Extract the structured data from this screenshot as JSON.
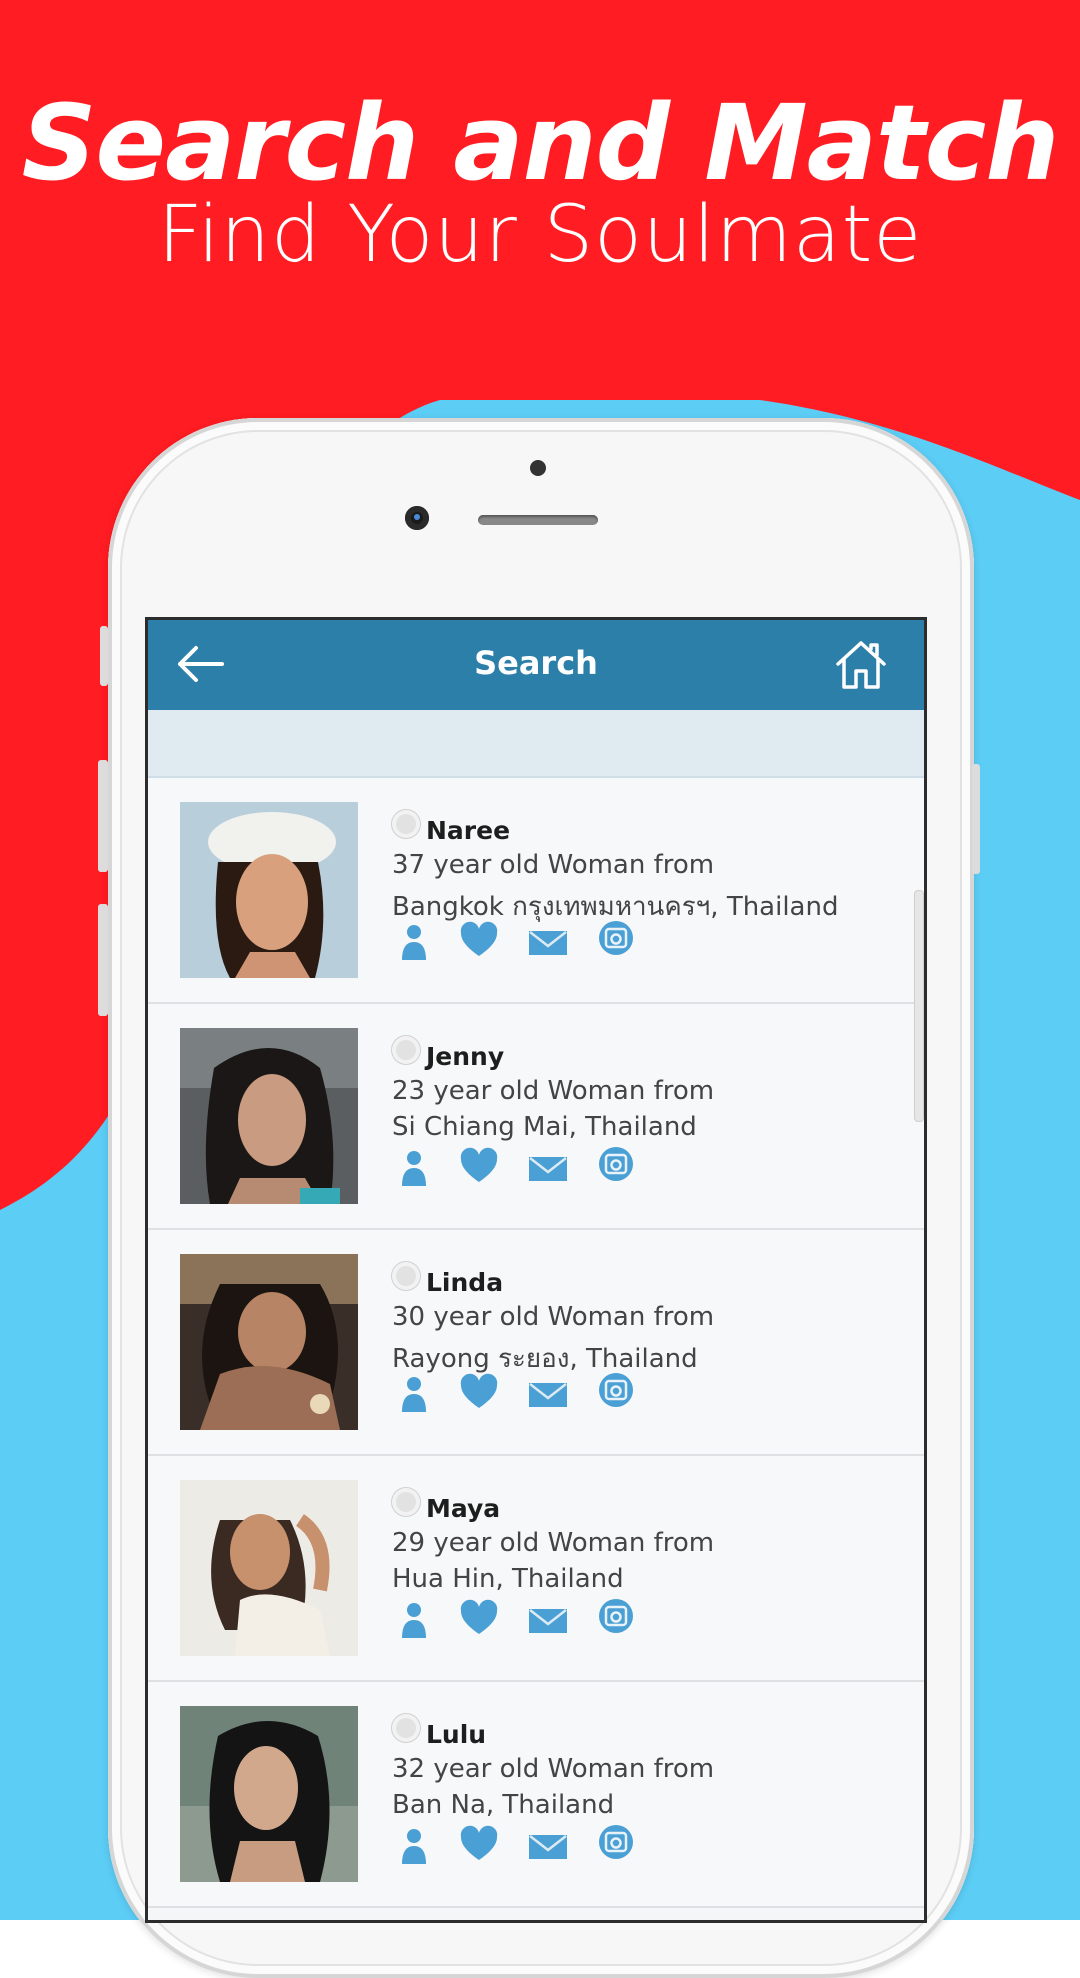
{
  "colors": {
    "red": "#ff1c22",
    "blue": "#5ccdf5",
    "navbar": "#2c7fa8",
    "icon_blue": "#4a9fd4"
  },
  "headline": {
    "title": "Search and Match",
    "subtitle": "Find Your Soulmate"
  },
  "app": {
    "title": "Search",
    "back_icon": "arrow-left-icon",
    "home_icon": "home-icon"
  },
  "profiles": [
    {
      "name": "Naree",
      "description": "37 year old Woman from",
      "location": "Bangkok กรุงเทพมหานครฯ, Thailand"
    },
    {
      "name": "Jenny",
      "description": "23 year old Woman from",
      "location": "Si Chiang Mai, Thailand"
    },
    {
      "name": "Linda",
      "description": "30 year old Woman from",
      "location": "Rayong ระยอง, Thailand"
    },
    {
      "name": "Maya",
      "description": "29 year old Woman from",
      "location": "Hua Hin, Thailand"
    },
    {
      "name": "Lulu",
      "description": "32 year old Woman from",
      "location": "Ban Na, Thailand"
    }
  ],
  "row_actions": [
    "profile-icon",
    "heart-icon",
    "mail-icon",
    "photo-icon"
  ]
}
